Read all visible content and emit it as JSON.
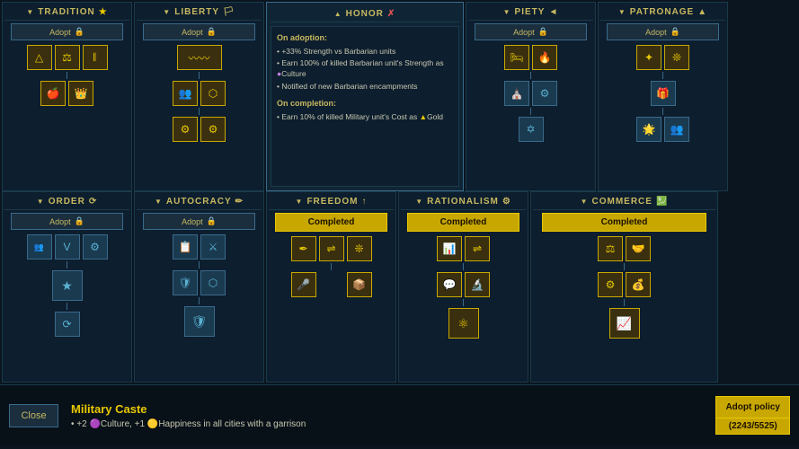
{
  "panels": {
    "top": [
      {
        "id": "tradition",
        "title": "TRADITION",
        "icon": "★",
        "status": "adopt",
        "hasLock": true,
        "icons": [
          [
            {
              "symbol": "△",
              "state": "completed"
            },
            {
              "symbol": "⚖",
              "state": "completed"
            },
            {
              "symbol": "𝄃",
              "state": "completed"
            }
          ],
          [
            {
              "symbol": "🍎",
              "state": "completed"
            },
            {
              "symbol": "👑",
              "state": "completed"
            }
          ]
        ]
      },
      {
        "id": "liberty",
        "title": "LIBERTY",
        "icon": "🏳",
        "status": "adopt",
        "hasLock": true,
        "icons": [
          [
            {
              "symbol": "〰",
              "state": "completed"
            }
          ],
          [
            {
              "symbol": "👥",
              "state": "completed"
            },
            {
              "symbol": "⬡",
              "state": "completed"
            }
          ],
          [
            {
              "symbol": "⚙",
              "state": "completed"
            },
            {
              "symbol": "⚙",
              "state": "completed"
            }
          ]
        ]
      },
      {
        "id": "honor",
        "title": "HONOR",
        "icon": "✗",
        "status": "info",
        "info": {
          "on_adoption_title": "On adoption:",
          "on_adoption_bullets": [
            "+33% Strength vs Barbarian units",
            "Earn 100% of killed Barbarian unit's Strength as ●Culture",
            "Notified of new Barbarian encampments"
          ],
          "on_completion_title": "On completion:",
          "on_completion_bullets": [
            "Earn 10% of killed Military unit's Cost as ▲Gold"
          ]
        }
      },
      {
        "id": "piety",
        "title": "PIETY",
        "icon": "◄",
        "status": "adopt",
        "hasLock": true,
        "icons": [
          [
            {
              "symbol": "🛏",
              "state": "completed"
            },
            {
              "symbol": "🔥",
              "state": "completed"
            }
          ],
          [
            {
              "symbol": "⛪",
              "state": "active"
            },
            {
              "symbol": "⚙",
              "state": "active"
            }
          ],
          [
            {
              "symbol": "✡",
              "state": "active"
            },
            {
              "symbol": "",
              "state": "empty"
            }
          ]
        ]
      },
      {
        "id": "patronage",
        "title": "PATRONAGE",
        "icon": "▲",
        "status": "adopt",
        "hasLock": true,
        "icons": [
          [
            {
              "symbol": "✦",
              "state": "completed"
            },
            {
              "symbol": "❊",
              "state": "completed"
            }
          ],
          [
            {
              "symbol": "🎁",
              "state": "active"
            },
            {
              "symbol": "",
              "state": "empty"
            }
          ],
          [
            {
              "symbol": "🌟",
              "state": "active"
            },
            {
              "symbol": "👥",
              "state": "active"
            }
          ]
        ]
      }
    ],
    "bottom": [
      {
        "id": "order",
        "title": "ORDER",
        "icon": "⟳",
        "status": "adopt",
        "hasLock": true,
        "icons": [
          [
            {
              "symbol": "👥",
              "state": "active"
            },
            {
              "symbol": "⚖",
              "state": "active"
            },
            {
              "symbol": "⚙",
              "state": "active"
            }
          ],
          [
            {
              "symbol": "★",
              "state": "active"
            }
          ],
          [
            {
              "symbol": "⟳",
              "state": "active"
            }
          ]
        ]
      },
      {
        "id": "autocracy",
        "title": "AUTOCRACY",
        "icon": "✏",
        "status": "adopt",
        "hasLock": true,
        "icons": [
          [
            {
              "symbol": "📋",
              "state": "active"
            },
            {
              "symbol": "⚔",
              "state": "active"
            }
          ],
          [
            {
              "symbol": "🛡",
              "state": "active"
            },
            {
              "symbol": "⬡",
              "state": "active"
            }
          ],
          [
            {
              "symbol": "🛡",
              "state": "active"
            }
          ]
        ]
      },
      {
        "id": "freedom",
        "title": "FREEDOM",
        "icon": "↑",
        "status": "completed",
        "icons": [
          [
            {
              "symbol": "✒",
              "state": "completed"
            },
            {
              "symbol": "⇌",
              "state": "completed"
            },
            {
              "symbol": "❊",
              "state": "completed"
            }
          ],
          [
            {
              "symbol": "🎤",
              "state": "completed"
            },
            {
              "symbol": "",
              "state": "empty"
            },
            {
              "symbol": "📦",
              "state": "completed"
            }
          ]
        ]
      },
      {
        "id": "rationalism",
        "title": "RATIONALISM",
        "icon": "⚙",
        "status": "completed",
        "icons": [
          [
            {
              "symbol": "📊",
              "state": "completed"
            },
            {
              "symbol": "⇌",
              "state": "completed"
            }
          ],
          [
            {
              "symbol": "💬",
              "state": "completed"
            },
            {
              "symbol": "🔬",
              "state": "completed"
            }
          ],
          [
            {
              "symbol": "⚛",
              "state": "completed"
            }
          ]
        ]
      },
      {
        "id": "commerce",
        "title": "COMMERCE",
        "icon": "💹",
        "status": "completed",
        "icons": [
          [
            {
              "symbol": "⚖",
              "state": "completed"
            },
            {
              "symbol": "🤝",
              "state": "completed"
            }
          ],
          [
            {
              "symbol": "⚙",
              "state": "completed"
            },
            {
              "symbol": "💰",
              "state": "completed"
            }
          ],
          [
            {
              "symbol": "📈",
              "state": "completed"
            }
          ]
        ]
      }
    ]
  },
  "bottom_bar": {
    "close_label": "Close",
    "policy_name": "Military Caste",
    "policy_desc": "• +2  🟣Culture, +1  🟡Happiness in all cities with a garrison",
    "adopt_label": "Adopt policy",
    "adopt_cost": "(2243/5525)"
  },
  "labels": {
    "adopt": "Adopt",
    "completed": "Completed",
    "on_adoption": "On adoption:",
    "on_completion": "On completion:"
  }
}
